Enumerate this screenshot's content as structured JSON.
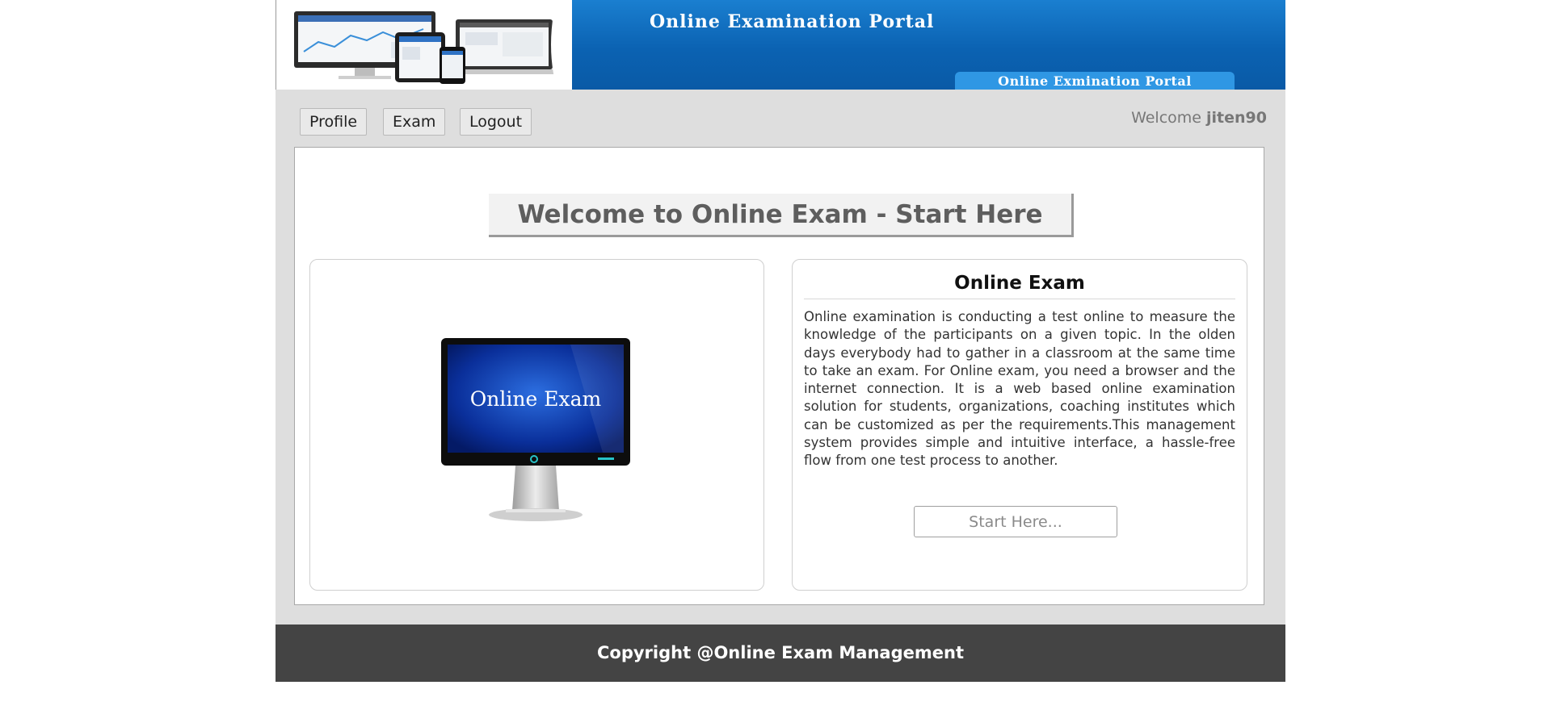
{
  "banner": {
    "title": "Online Examination Portal",
    "tag": "Online Exmination Portal"
  },
  "nav": {
    "items": [
      {
        "label": "Profile"
      },
      {
        "label": "Exam"
      },
      {
        "label": "Logout"
      }
    ],
    "welcome_text": "Welcome",
    "username": "jiten90"
  },
  "main": {
    "heading": "Welcome to Online Exam - Start Here",
    "image_caption": "Online Exam",
    "info": {
      "title": "Online Exam",
      "body": "Online examination is conducting a test online to measure the knowledge of the participants on a given topic. In the olden days everybody had to gather in a classroom at the same time to take an exam. For Online exam, you need a browser and the internet connection. It is a web based online examination solution for students, organizations, coaching institutes which can be customized as per the requirements.This management system provides simple and intuitive interface, a hassle-free flow from one test process to another.",
      "button_label": "Start Here..."
    }
  },
  "footer": {
    "text": "Copyright @Online Exam Management"
  },
  "colors": {
    "banner_blue": "#0b62b2",
    "page_bg": "#dedede",
    "footer_bg": "#444444"
  }
}
